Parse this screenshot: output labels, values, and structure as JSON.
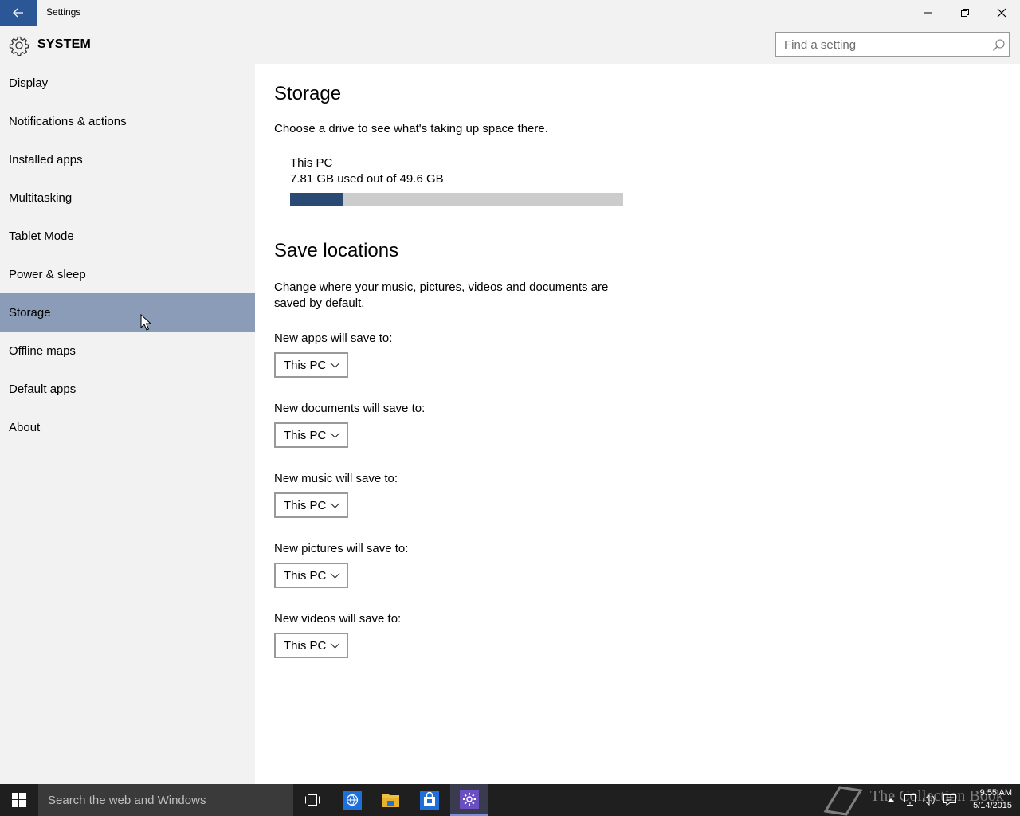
{
  "window": {
    "title": "Settings"
  },
  "header": {
    "section": "SYSTEM",
    "search_placeholder": "Find a setting"
  },
  "sidebar": {
    "items": [
      {
        "label": "Display"
      },
      {
        "label": "Notifications & actions"
      },
      {
        "label": "Installed apps"
      },
      {
        "label": "Multitasking"
      },
      {
        "label": "Tablet Mode"
      },
      {
        "label": "Power & sleep"
      },
      {
        "label": "Storage"
      },
      {
        "label": "Offline maps"
      },
      {
        "label": "Default apps"
      },
      {
        "label": "About"
      }
    ],
    "active_index": 6
  },
  "main": {
    "storage_heading": "Storage",
    "storage_desc": "Choose a drive to see what's taking up space there.",
    "drive": {
      "name": "This PC",
      "usage": "7.81 GB used out of 49.6 GB",
      "used_fraction": 0.157
    },
    "save_heading": "Save locations",
    "save_desc_1": "Change where your music, pictures, videos and documents are",
    "save_desc_2": "saved by default.",
    "locations": [
      {
        "label": "New apps will save to:",
        "value": "This PC"
      },
      {
        "label": "New documents will save to:",
        "value": "This PC"
      },
      {
        "label": "New music will save to:",
        "value": "This PC"
      },
      {
        "label": "New pictures will save to:",
        "value": "This PC"
      },
      {
        "label": "New videos will save to:",
        "value": "This PC"
      }
    ]
  },
  "taskbar": {
    "search_placeholder": "Search the web and Windows",
    "time": "9:55 AM",
    "date": "5/14/2015",
    "watermark": "The Collection Book"
  },
  "colors": {
    "accent": "#2b5797",
    "active_nav": "#8a9cb8",
    "usage_bar": "#2b4a73",
    "taskbar": "#1f1f1f"
  }
}
